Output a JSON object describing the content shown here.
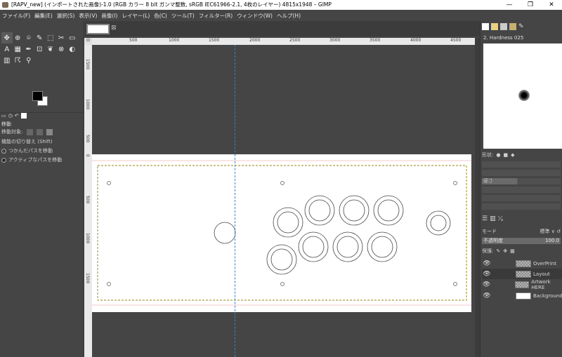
{
  "window": {
    "title": "[RAPV_new] (インポートされた画像)-1.0 (RGB カラー 8 bit ガンマ整数, sRGB IEC61966-2.1, 4枚のレイヤー) 4815x1948 – GIMP",
    "controls": [
      "—",
      "❐",
      "✕"
    ]
  },
  "menu": [
    "ファイル(F)",
    "編集(E)",
    "選択(S)",
    "表示(V)",
    "画像(I)",
    "レイヤー(L)",
    "色(C)",
    "ツール(T)",
    "フィルター(R)",
    "ウィンドウ(W)",
    "ヘルプ(H)"
  ],
  "toolbox": {
    "tools": [
      "✥",
      "⊕",
      "⌾",
      "✎",
      "⬚",
      "✂",
      "▭",
      "A",
      "▦",
      "✒",
      "⊡",
      "❦",
      "⊗",
      "◐",
      "▥",
      "☈",
      "⚲"
    ],
    "options_title": "移動",
    "move_target_label": "移動対象:",
    "toggle_label": "機能の切り替え (Shift)",
    "option1": "つかんだパスを移動",
    "option2": "アクティブなパスを移動"
  },
  "ruler": {
    "h_labels": [
      "500",
      "1000",
      "1500",
      "2000",
      "2500",
      "3000",
      "3500",
      "4000",
      "4500"
    ],
    "v_labels": [
      "1500",
      "1000",
      "500",
      "0",
      "500",
      "1000",
      "1500"
    ]
  },
  "right_panel": {
    "brush_name": "2. Hardness 025",
    "shape_label": "形状:",
    "slider_hardness": "硬さ",
    "mode_label": "モード",
    "mode_value": "標準",
    "opacity_label": "不透明度",
    "opacity_value": "100.0",
    "lock_label": "保護:",
    "layers": [
      {
        "name": "OverPrint",
        "thumb": "checker",
        "selected": false
      },
      {
        "name": "Layout",
        "thumb": "checker",
        "selected": true
      },
      {
        "name": "Artwork HERE",
        "thumb": "checker",
        "selected": false
      },
      {
        "name": "Background",
        "thumb": "white",
        "selected": false
      }
    ]
  }
}
